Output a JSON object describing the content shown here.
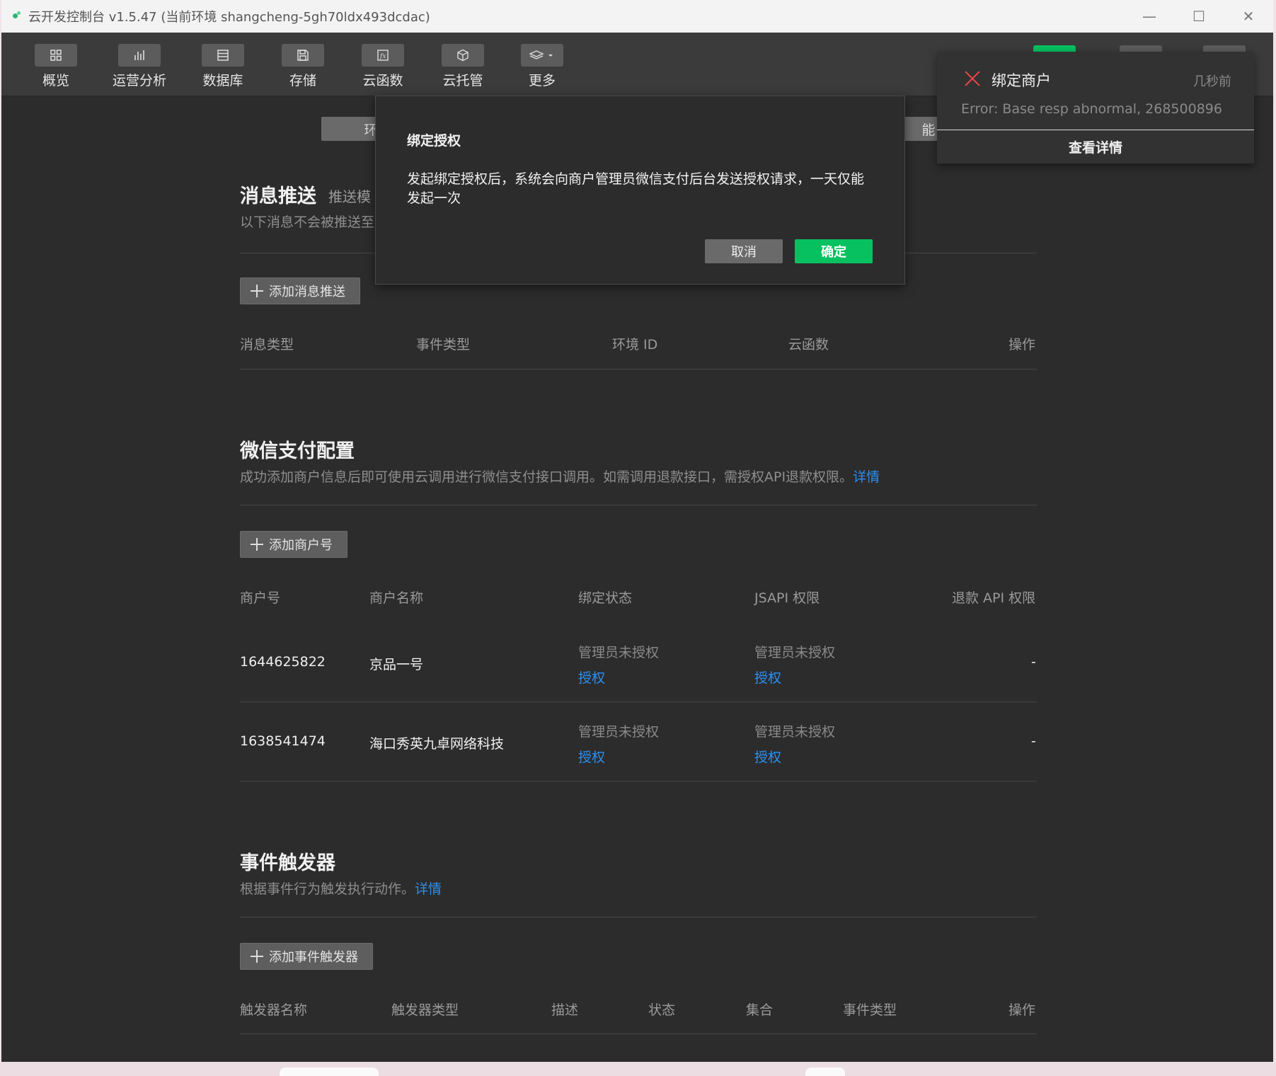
{
  "window": {
    "title": "云开发控制台 v1.5.47 (当前环境 shangcheng-5gh70ldx493dcdac)",
    "controls": [
      "minimize",
      "maximize",
      "close"
    ]
  },
  "toolbar": {
    "items": [
      {
        "label": "概览",
        "icon": "grid-icon"
      },
      {
        "label": "运营分析",
        "icon": "bar-chart-icon"
      },
      {
        "label": "数据库",
        "icon": "database-icon"
      },
      {
        "label": "存储",
        "icon": "floppy-icon"
      },
      {
        "label": "云函数",
        "icon": "function-icon"
      },
      {
        "label": "云托管",
        "icon": "cube-icon"
      },
      {
        "label": "更多",
        "icon": "layers-icon"
      }
    ]
  },
  "tabs": {
    "left_partial": "环",
    "right_partial": "能"
  },
  "message_push": {
    "title": "消息推送",
    "subtitle_partial": "推送模",
    "desc_partial": "以下消息不会被推送至",
    "add_button": "添加消息推送",
    "columns": [
      "消息类型",
      "事件类型",
      "环境 ID",
      "云函数",
      "操作"
    ]
  },
  "wechat_pay": {
    "title": "微信支付配置",
    "desc": "成功添加商户信息后即可使用云调用进行微信支付接口调用。如需调用退款接口，需授权API退款权限。",
    "desc_link": "详情",
    "add_button": "添加商户号",
    "columns": [
      "商户号",
      "商户名称",
      "绑定状态",
      "JSAPI 权限",
      "退款 API 权限"
    ],
    "rows": [
      {
        "merchant_id": "1644625822",
        "name": "京品一号",
        "bind_status": "管理员未授权",
        "bind_action": "授权",
        "jsapi_status": "管理员未授权",
        "jsapi_action": "授权",
        "refund": "-"
      },
      {
        "merchant_id": "1638541474",
        "name": "海口秀英九卓网络科技",
        "bind_status": "管理员未授权",
        "bind_action": "授权",
        "jsapi_status": "管理员未授权",
        "jsapi_action": "授权",
        "refund": "-"
      }
    ]
  },
  "event_trigger": {
    "title": "事件触发器",
    "desc": "根据事件行为触发执行动作。",
    "desc_link": "详情",
    "add_button": "添加事件触发器",
    "columns": [
      "触发器名称",
      "触发器类型",
      "描述",
      "状态",
      "集合",
      "事件类型",
      "操作"
    ]
  },
  "modal": {
    "title": "绑定授权",
    "body": "发起绑定授权后，系统会向商户管理员微信支付后台发送授权请求，一天仅能发起一次",
    "cancel": "取消",
    "confirm": "确定"
  },
  "toast": {
    "title": "绑定商户",
    "time": "几秒前",
    "message": "Error: Base resp abnormal, 268500896",
    "detail_button": "查看详情"
  },
  "colors": {
    "accent_green": "#07c160",
    "link_blue": "#2d8ff0",
    "error_red": "#f24545"
  }
}
